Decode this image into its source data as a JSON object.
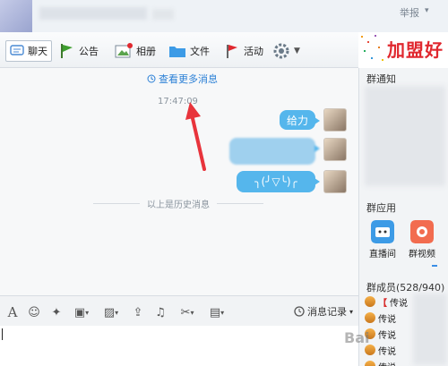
{
  "titlebar": {
    "report": "举报"
  },
  "toolbar": {
    "chat": "聊天",
    "notice": "公告",
    "album": "相册",
    "file": "文件",
    "activity": "活动"
  },
  "banner": {
    "text": "加盟好"
  },
  "chat": {
    "view_more": "查看更多消息",
    "time": "17:47:09",
    "messages": [
      {
        "text": "给力"
      },
      {
        "text": ""
      },
      {
        "text": "╮(╯▽╰)╭"
      }
    ],
    "history_divider": "以上是历史消息"
  },
  "input_toolbar": {
    "message_record": "消息记录"
  },
  "right_panel": {
    "notice_title": "群通知",
    "apps_title": "群应用",
    "apps": [
      {
        "label": "直播间"
      },
      {
        "label": "群视频"
      }
    ],
    "members_title": "群成员(528/940)",
    "members": [
      {
        "badge": "【",
        "text": "传说"
      },
      {
        "badge": "",
        "text": "传说"
      },
      {
        "badge": "",
        "text": "传说"
      },
      {
        "badge": "",
        "text": "传说"
      },
      {
        "badge": "",
        "text": "传说"
      }
    ]
  },
  "watermark": "Bai"
}
